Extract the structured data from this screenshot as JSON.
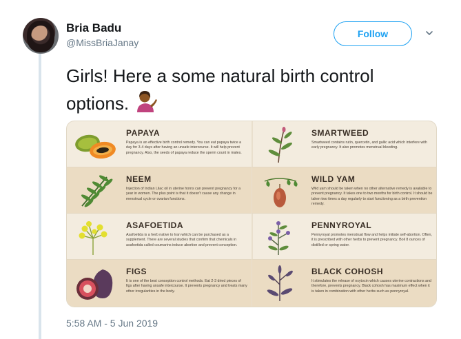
{
  "author": {
    "name": "Bria Badu",
    "handle": "@MissBriaJanay"
  },
  "follow_label": "Follow",
  "tweet": {
    "text": "Girls! Here a some natural birth control options.",
    "emoji": "person-tipping-hand-icon"
  },
  "timestamp": "5:58 AM - 5 Jun 2019",
  "card": {
    "left": [
      {
        "title": "PAPAYA",
        "icon": "papaya-icon",
        "desc": "Papaya is an effective birth control remedy. You can eat papaya twice a day for 3-4 days after having an unsafe intercourse. It will help prevent pregnancy. Also, the seeds of papaya reduce the sperm count in males."
      },
      {
        "title": "NEEM",
        "icon": "neem-leaf-icon",
        "desc": "Injection of Indian Lilac oil in uterine horns can prevent pregnancy for a year in women. The plus point is that it doesn't cause any change in menstrual cycle or ovarian functions."
      },
      {
        "title": "ASAFOETIDA",
        "icon": "asafoetida-flower-icon",
        "desc": "Asafoetida is a herb native to Iran which can be purchased as a supplement. There are several studies that confirm that chemicals in asafoetida called coumarins induce abortion and prevent conception."
      },
      {
        "title": "FIGS",
        "icon": "fig-icon",
        "desc": "It is one of the best conception control methods. Eat 2-3 dried pieces of figs after having unsafe intercourse. It prevents pregnancy and treats many other irregularities in the body."
      }
    ],
    "right": [
      {
        "title": "SMARTWEED",
        "icon": "smartweed-icon",
        "desc": "Smartweed contains rutin, quercetin, and gallic acid which interfere with early pregnancy. It also promotes menstrual bleeding."
      },
      {
        "title": "WILD YAM",
        "icon": "wild-yam-icon",
        "desc": "Wild yam should be taken when no other alternative remedy is available to prevent pregnancy. It takes one to two months for birth control. It should be taken two times a day regularly to start functioning as a birth prevention remedy."
      },
      {
        "title": "PENNYROYAL",
        "icon": "pennyroyal-icon",
        "desc": "Pennyroyal promotes menstrual flow and helps initiate self-abortion. Often, it is prescribed with other herbs to prevent pregnancy. Boil 8 ounces of distilled or spring water."
      },
      {
        "title": "BLACK COHOSH",
        "icon": "black-cohosh-icon",
        "desc": "It stimulates the release of oxytocin which causes uterine contractions and therefore, prevents pregnancy. Black cohosh has maximum effect when it is taken in combination with other herbs such as pennyroyal."
      }
    ]
  },
  "colors": {
    "accent": "#1da1f2",
    "secondary_text": "#657786",
    "card_bg": "#f3ecdf",
    "card_alt_bg": "#ebdcc3"
  }
}
